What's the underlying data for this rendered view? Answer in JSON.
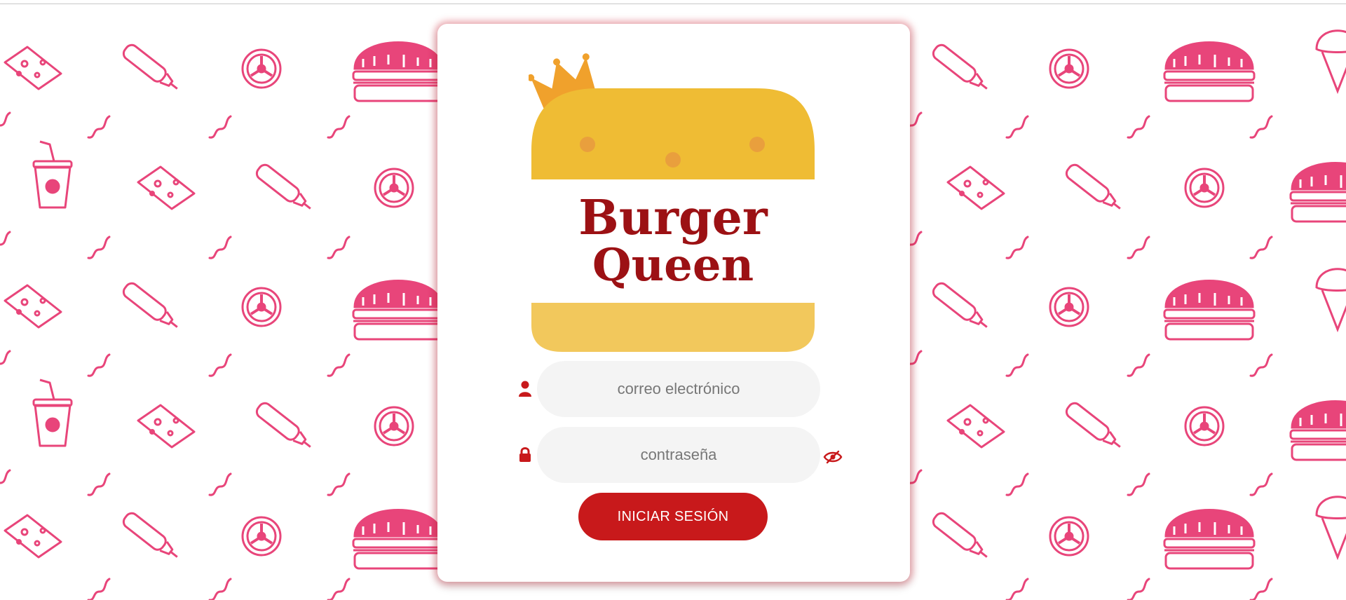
{
  "brand": {
    "name_line1": "Burger",
    "name_line2": "Queen",
    "bun_color": "#efbc34",
    "text_color": "#9c1114",
    "crown_color": "#f0a12c"
  },
  "pattern": {
    "color": "#e8457a"
  },
  "login": {
    "email_placeholder": "correo electrónico",
    "password_placeholder": "contraseña",
    "email_icon": "user-icon",
    "password_icon": "lock-icon",
    "toggle_icon": "eye-slash-icon",
    "submit_label": "INICIAR SESIÓN",
    "accent_color": "#c8191b"
  }
}
